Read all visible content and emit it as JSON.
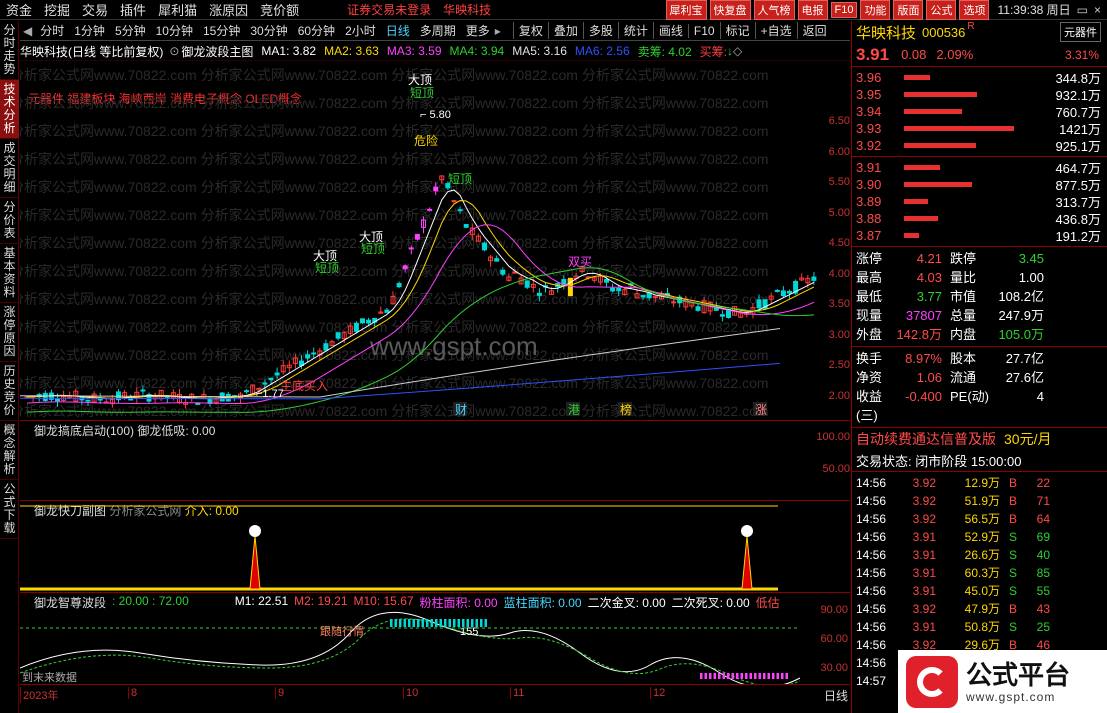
{
  "menubar": {
    "items": [
      "资金",
      "挖掘",
      "交易",
      "插件",
      "犀利猫",
      "涨原因",
      "竞价额"
    ],
    "login_warning": "证券交易未登录",
    "login_name": "华映科技",
    "right_buttons": [
      "犀利宝",
      "快复盘",
      "人气榜",
      "电报",
      "F10",
      "功能",
      "版面",
      "公式",
      "选项"
    ],
    "clock": "11:39:38 周日",
    "window_controls": [
      "▭",
      "×"
    ]
  },
  "left_tabs": [
    {
      "label": "分时走势",
      "active": false
    },
    {
      "label": "技术分析",
      "active": true
    },
    {
      "label": "成交明细",
      "active": false
    },
    {
      "label": "分价表",
      "active": false
    },
    {
      "label": "基本资料",
      "active": false
    },
    {
      "label": "涨停原因",
      "active": false
    },
    {
      "label": "历史竞价",
      "active": false
    },
    {
      "label": "概念解析",
      "active": false
    },
    {
      "label": "公式下载",
      "active": false
    }
  ],
  "periods": {
    "items": [
      "分时",
      "1分钟",
      "5分钟",
      "10分钟",
      "15分钟",
      "30分钟",
      "60分钟",
      "2小时",
      "日线",
      "多周期",
      "更多"
    ],
    "active": "日线"
  },
  "tools": [
    "复权",
    "叠加",
    "多股",
    "统计",
    "画线",
    "F10",
    "标记",
    "+自选",
    "返回"
  ],
  "chart_info": {
    "title": "华映科技(日线 等比前复权)",
    "indicator": "御龙波段主图",
    "ma": [
      {
        "label": "MA1: 3.82",
        "color": "#ffffff"
      },
      {
        "label": "MA2: 3.63",
        "color": "#ffd700"
      },
      {
        "label": "MA3: 3.59",
        "color": "#ff40ff"
      },
      {
        "label": "MA4: 3.94",
        "color": "#2fd02f"
      },
      {
        "label": "MA5: 3.16",
        "color": "#e0e0e0"
      },
      {
        "label": "MA6: 2.56",
        "color": "#3050ff"
      },
      {
        "label": "卖筹: 4.02",
        "color": "#2fd02f"
      },
      {
        "label": "买筹:",
        "color": "#ff4040"
      }
    ]
  },
  "concepts": "元器件 福建板块 海峡西岸 消费电子概念 OLED概念",
  "main_axis": [
    "6.50",
    "6.00",
    "5.50",
    "5.00",
    "4.50",
    "4.00",
    "3.50",
    "3.00",
    "2.50",
    "2.00"
  ],
  "annotations": {
    "top_label": "大顶",
    "top_green": "短顶",
    "high": "5.80",
    "danger": "危险",
    "short_top": "短顶",
    "big_top1": "大顶",
    "short_top1": "短顶",
    "big_top2": "大顶",
    "short_top2": "短顶",
    "double_buy": "双买",
    "bottom_buy": "主底买入",
    "low": "1.77"
  },
  "event_tags": [
    {
      "t": "财",
      "c": "#46d8ff"
    },
    {
      "t": "港",
      "c": "#2fd02f"
    },
    {
      "t": "榜",
      "c": "#ffd700"
    },
    {
      "t": "涨",
      "c": "#ff8080"
    }
  ],
  "watermark": "www.gspt.com",
  "wm_text": "分析家公式网www.70822.com 分析家公式网www.70822.com 分析家公式网www.70822.com 分析家公式网www.70822.com",
  "panel1": {
    "name": "御龙搞底启动(100) 御龙低吸: 0.00",
    "axis": [
      "100.00",
      "50.00"
    ]
  },
  "panel2": {
    "name": "御龙快刀副图 ",
    "name2": "分析家公式网",
    "value": "介入: 0.00"
  },
  "panel3": {
    "name": "御龙智尊波段",
    "v1": ": 20.00 : 72.00",
    "m1": "M1: 22.51",
    "m2": "M2: 19.21",
    "m10": "M10: 15.67",
    "pink": "粉柱面积: 0.00",
    "blue": "蓝柱面积: 0.00",
    "gold": "二次金叉: 0.00",
    "dead": "二次死叉: 0.00",
    "low": "低估",
    "axis": [
      "90.00",
      "60.00",
      "30.00"
    ],
    "ann_follow": "跟随行情",
    "ann_155": "155",
    "ann_bottom": "到末来数据"
  },
  "timeline": {
    "labels": [
      "2023年",
      "8",
      "9",
      "10",
      "11",
      "12"
    ],
    "period": "日线"
  },
  "stock": {
    "name": "华映科技",
    "code": "000536",
    "flag": "R",
    "sector": "元器件",
    "sector_pct": "3.31%",
    "price": "3.91",
    "change": "0.08",
    "pct": "2.09%"
  },
  "asks": [
    {
      "p": "3.96",
      "v": "344.8万",
      "w": 0.24
    },
    {
      "p": "3.95",
      "v": "932.1万",
      "w": 0.66
    },
    {
      "p": "3.94",
      "v": "760.7万",
      "w": 0.53
    },
    {
      "p": "3.93",
      "v": "1421万",
      "w": 1.0
    },
    {
      "p": "3.92",
      "v": "925.1万",
      "w": 0.65
    }
  ],
  "bids": [
    {
      "p": "3.91",
      "v": "464.7万",
      "w": 0.33
    },
    {
      "p": "3.90",
      "v": "877.5万",
      "w": 0.62
    },
    {
      "p": "3.89",
      "v": "313.7万",
      "w": 0.22
    },
    {
      "p": "3.88",
      "v": "436.8万",
      "w": 0.31
    },
    {
      "p": "3.87",
      "v": "191.2万",
      "w": 0.14
    }
  ],
  "stats": [
    [
      "涨停",
      "4.21",
      "跌停",
      "3.45"
    ],
    [
      "最高",
      "4.03",
      "量比",
      "1.00"
    ],
    [
      "最低",
      "3.77",
      "市值",
      "108.2亿"
    ],
    [
      "现量",
      "37807",
      "总量",
      "247.9万"
    ],
    [
      "外盘",
      "142.8万",
      "内盘",
      "105.0万"
    ]
  ],
  "stats2": [
    [
      "换手",
      "8.97%",
      "股本",
      "27.7亿"
    ],
    [
      "净资",
      "1.06",
      "流通",
      "27.6亿"
    ],
    [
      "收益(三)",
      "-0.400",
      "PE(动)",
      "4"
    ]
  ],
  "promo": "自动续费通达信普及版",
  "promo_price": "30元/月",
  "trade_status": "交易状态: 闭市阶段 15:00:00",
  "ticks": [
    [
      "14:56",
      "3.92",
      "12.9万",
      "B",
      "22"
    ],
    [
      "14:56",
      "3.92",
      "51.9万",
      "B",
      "71"
    ],
    [
      "14:56",
      "3.92",
      "56.5万",
      "B",
      "64"
    ],
    [
      "14:56",
      "3.91",
      "52.9万",
      "S",
      "69"
    ],
    [
      "14:56",
      "3.91",
      "26.6万",
      "S",
      "40"
    ],
    [
      "14:56",
      "3.91",
      "60.3万",
      "S",
      "85"
    ],
    [
      "14:56",
      "3.91",
      "45.0万",
      "S",
      "55"
    ],
    [
      "14:56",
      "3.92",
      "47.9万",
      "B",
      "43"
    ],
    [
      "14:56",
      "3.91",
      "50.8万",
      "S",
      "25"
    ],
    [
      "14:56",
      "3.92",
      "29.6万",
      "B",
      "46"
    ],
    [
      "14:56",
      "3.91",
      "",
      "S",
      ""
    ],
    [
      "14:57",
      "",
      "",
      "",
      ""
    ]
  ],
  "logo": {
    "name": "公式平台",
    "url": "www.gspt.com"
  }
}
